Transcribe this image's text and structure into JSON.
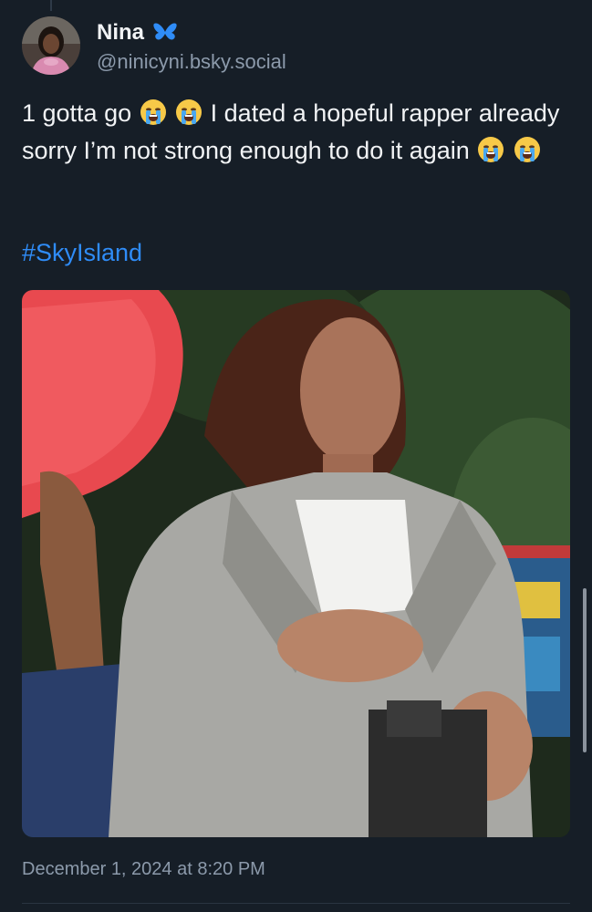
{
  "post": {
    "author": {
      "display_name": "Nina",
      "handle": "@ninicyni.bsky.social",
      "badge_icon": "butterfly-icon",
      "badge_color": "#2f8cf7"
    },
    "text": {
      "segment_1": "1 gotta go",
      "segment_2": "I dated a hopeful rapper already sorry I’m not strong enough to do it again"
    },
    "emoji": "loudly-crying-face",
    "hashtag": "#SkyIsland",
    "timestamp": "December 1, 2024 at 8:20 PM"
  },
  "colors": {
    "background": "#161e27",
    "text": "#f1f3f5",
    "muted": "#8c9aab",
    "link": "#2f8cf7"
  }
}
